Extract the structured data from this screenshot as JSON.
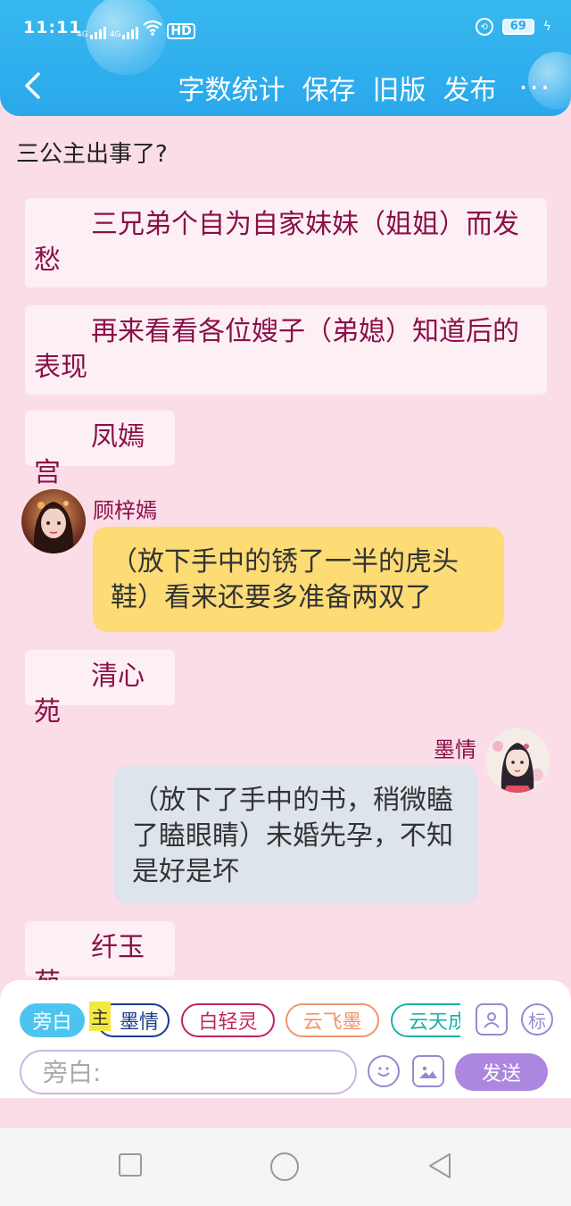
{
  "status": {
    "time": "11:11",
    "network": [
      "4G",
      "4G"
    ],
    "hd_label": "HD",
    "battery": "69"
  },
  "header": {
    "actions": {
      "word_count": "字数统计",
      "save": "保存",
      "old_version": "旧版",
      "publish": "发布",
      "more": "···"
    }
  },
  "document": {
    "title": "三公主出事了?",
    "narrations": [
      "三兄弟个自为自家妹妹（姐姐）而发愁",
      "再来看看各位嫂子（弟媳）知道后的表现",
      "凤嫣宫",
      "清心苑",
      "纤玉苑"
    ],
    "messages": [
      {
        "speaker": "顾梓嫣",
        "text": "（放下手中的锈了一半的虎头鞋）看来还要多准备两双了"
      },
      {
        "speaker": "墨情",
        "text": "（放下了手中的书，稍微瞌了瞌眼睛）未婚先孕，不知是好是坏"
      }
    ]
  },
  "composer": {
    "roles": {
      "narration": "旁白",
      "main_tag": "主",
      "moqing": "墨情",
      "baiqingling": "白轻灵",
      "yunfeimo": "云飞墨",
      "yuntian": "云天成"
    },
    "tools": {
      "character_icon": "person-icon",
      "tag_label": "标"
    },
    "input_placeholder": "旁白:",
    "send_label": "发送"
  },
  "colors": {
    "header": "#2aa8ec",
    "background": "#fbdde8",
    "narration_text": "#8a1048",
    "speech_yellow": "#fddc76",
    "speech_grey": "#dde4ec",
    "send_button": "#ac86df"
  }
}
